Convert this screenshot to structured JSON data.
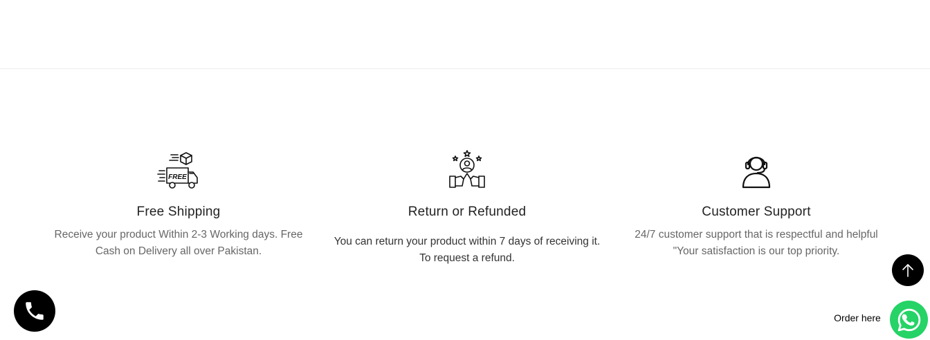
{
  "features": [
    {
      "icon": "free-delivery-truck-icon",
      "title": "Free Shipping",
      "desc_line1": "Receive your product Within 2-3 Working days. Free",
      "desc_line2": "Cash on Delivery all over Pakistan."
    },
    {
      "icon": "refund-handshake-icon",
      "title": "Return or Refunded",
      "desc_line1": "You can return your product within 7 days of receiving it.",
      "desc_line2": "To request a refund."
    },
    {
      "icon": "customer-support-headset-icon",
      "title": "Customer Support",
      "desc_line1": "24/7 customer support that is respectful and helpful",
      "desc_line2": "\"Your satisfaction is our top priority."
    }
  ],
  "floating": {
    "order_label": "Order here",
    "scroll_top_icon": "arrow-up-icon",
    "call_icon": "phone-icon",
    "whatsapp_icon": "whatsapp-icon"
  },
  "colors": {
    "whatsapp": "#25d366",
    "dark_button": "#000000",
    "title_text": "#222222",
    "desc_text": "#666666"
  }
}
